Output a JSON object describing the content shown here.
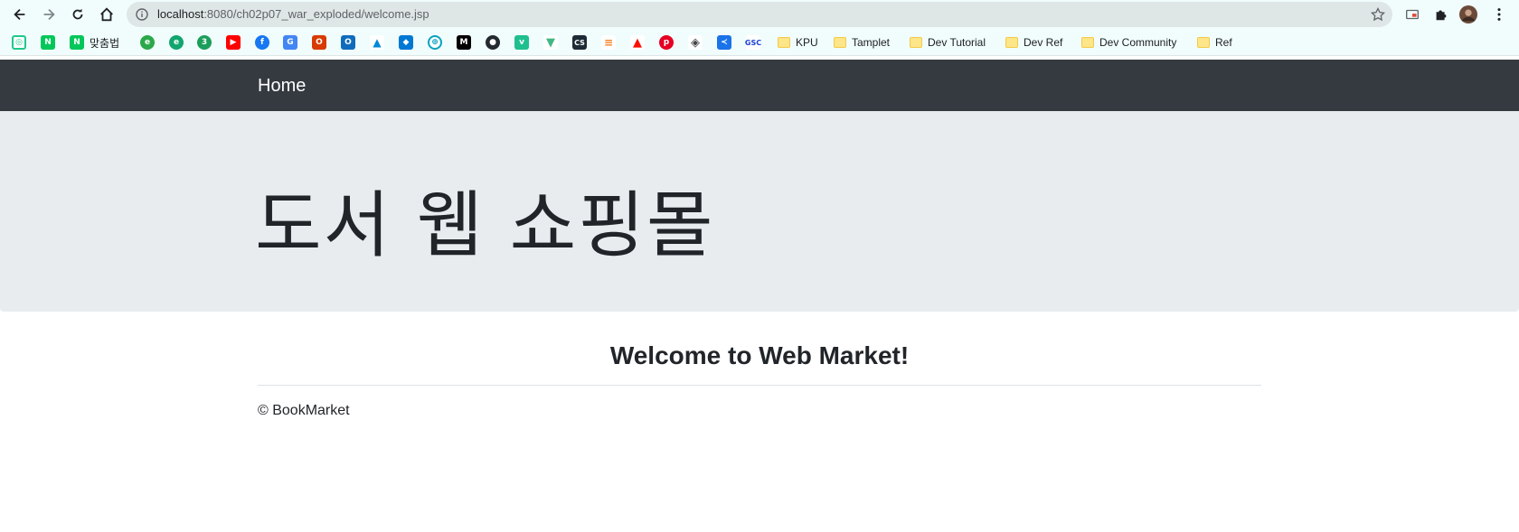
{
  "browser": {
    "url_host": "localhost",
    "url_path": ":8080/ch02p07_war_exploded/welcome.jsp"
  },
  "bookmarks": [
    {
      "icon": "notion-like-icon",
      "label": ""
    },
    {
      "icon": "naver-icon",
      "label": ""
    },
    {
      "icon": "naver-icon",
      "label": "맞춤법"
    },
    {
      "icon": "bookmark-icon",
      "label": ""
    },
    {
      "icon": "edge-icon",
      "label": ""
    },
    {
      "icon": "bookmark-icon",
      "label": ""
    },
    {
      "icon": "youtube-icon",
      "label": ""
    },
    {
      "icon": "facebook-icon",
      "label": ""
    },
    {
      "icon": "translate-icon",
      "label": ""
    },
    {
      "icon": "office-icon",
      "label": ""
    },
    {
      "icon": "outlook-icon",
      "label": ""
    },
    {
      "icon": "azure-icon",
      "label": ""
    },
    {
      "icon": "devops-icon",
      "label": ""
    },
    {
      "icon": "globe-icon",
      "label": ""
    },
    {
      "icon": "medium-icon",
      "label": ""
    },
    {
      "icon": "github-icon",
      "label": ""
    },
    {
      "icon": "v-icon",
      "label": ""
    },
    {
      "icon": "vue-icon",
      "label": ""
    },
    {
      "icon": "cs-icon",
      "label": ""
    },
    {
      "icon": "stackoverflow-icon",
      "label": ""
    },
    {
      "icon": "adobe-icon",
      "label": ""
    },
    {
      "icon": "pinterest-icon",
      "label": ""
    },
    {
      "icon": "diamond-icon",
      "label": ""
    },
    {
      "icon": "share-icon",
      "label": ""
    },
    {
      "icon": "gsc-icon",
      "label": ""
    }
  ],
  "folders": [
    {
      "label": "KPU"
    },
    {
      "label": "Tamplet"
    },
    {
      "label": "Dev Tutorial"
    },
    {
      "label": "Dev Ref"
    },
    {
      "label": "Dev Community"
    },
    {
      "label": "Ref"
    }
  ],
  "page": {
    "nav_brand": "Home",
    "jumbotron_title": "도서 웹 쇼핑몰",
    "welcome": "Welcome to Web Market!",
    "footer": "© BookMarket"
  },
  "colors": {
    "navbar": "#343a40",
    "jumbotron": "#e9ecef"
  }
}
